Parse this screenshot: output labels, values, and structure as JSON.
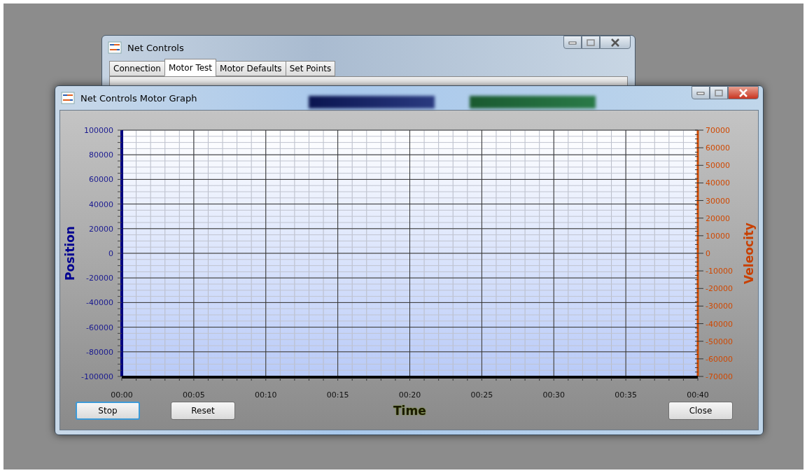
{
  "back_window": {
    "title": "Net Controls",
    "tabs": [
      {
        "label": "Connection",
        "selected": false
      },
      {
        "label": "Motor Test",
        "selected": true
      },
      {
        "label": "Motor Defaults",
        "selected": false
      },
      {
        "label": "Set Points",
        "selected": false
      }
    ]
  },
  "graph_window": {
    "title": "Net Controls Motor Graph",
    "chart": {
      "chart_data": {
        "type": "line",
        "grid": true,
        "xlabel": "Time",
        "ylabel": "Position",
        "y2label": "Veleocity",
        "xlim": [
          0,
          40
        ],
        "ylim": [
          -100000,
          100000
        ],
        "y2lim": [
          -70000,
          70000
        ],
        "xticks": [
          {
            "value": 0,
            "label": "00:00"
          },
          {
            "value": 5,
            "label": "00:05"
          },
          {
            "value": 10,
            "label": "00:10"
          },
          {
            "value": 15,
            "label": "00:15"
          },
          {
            "value": 20,
            "label": "00:20"
          },
          {
            "value": 25,
            "label": "00:25"
          },
          {
            "value": 30,
            "label": "00:30"
          },
          {
            "value": 35,
            "label": "00:35"
          },
          {
            "value": 40,
            "label": "00:40"
          }
        ],
        "yticks": [
          100000,
          80000,
          60000,
          40000,
          20000,
          0,
          -20000,
          -40000,
          -60000,
          -80000,
          -100000
        ],
        "y2ticks": [
          70000,
          60000,
          50000,
          40000,
          30000,
          20000,
          10000,
          0,
          -10000,
          -20000,
          -30000,
          -40000,
          -50000,
          -60000,
          -70000
        ]
      }
    },
    "buttons": [
      {
        "label": "Stop",
        "focused": true
      },
      {
        "label": "Reset",
        "focused": false
      },
      {
        "label": "Close",
        "focused": false
      }
    ]
  }
}
